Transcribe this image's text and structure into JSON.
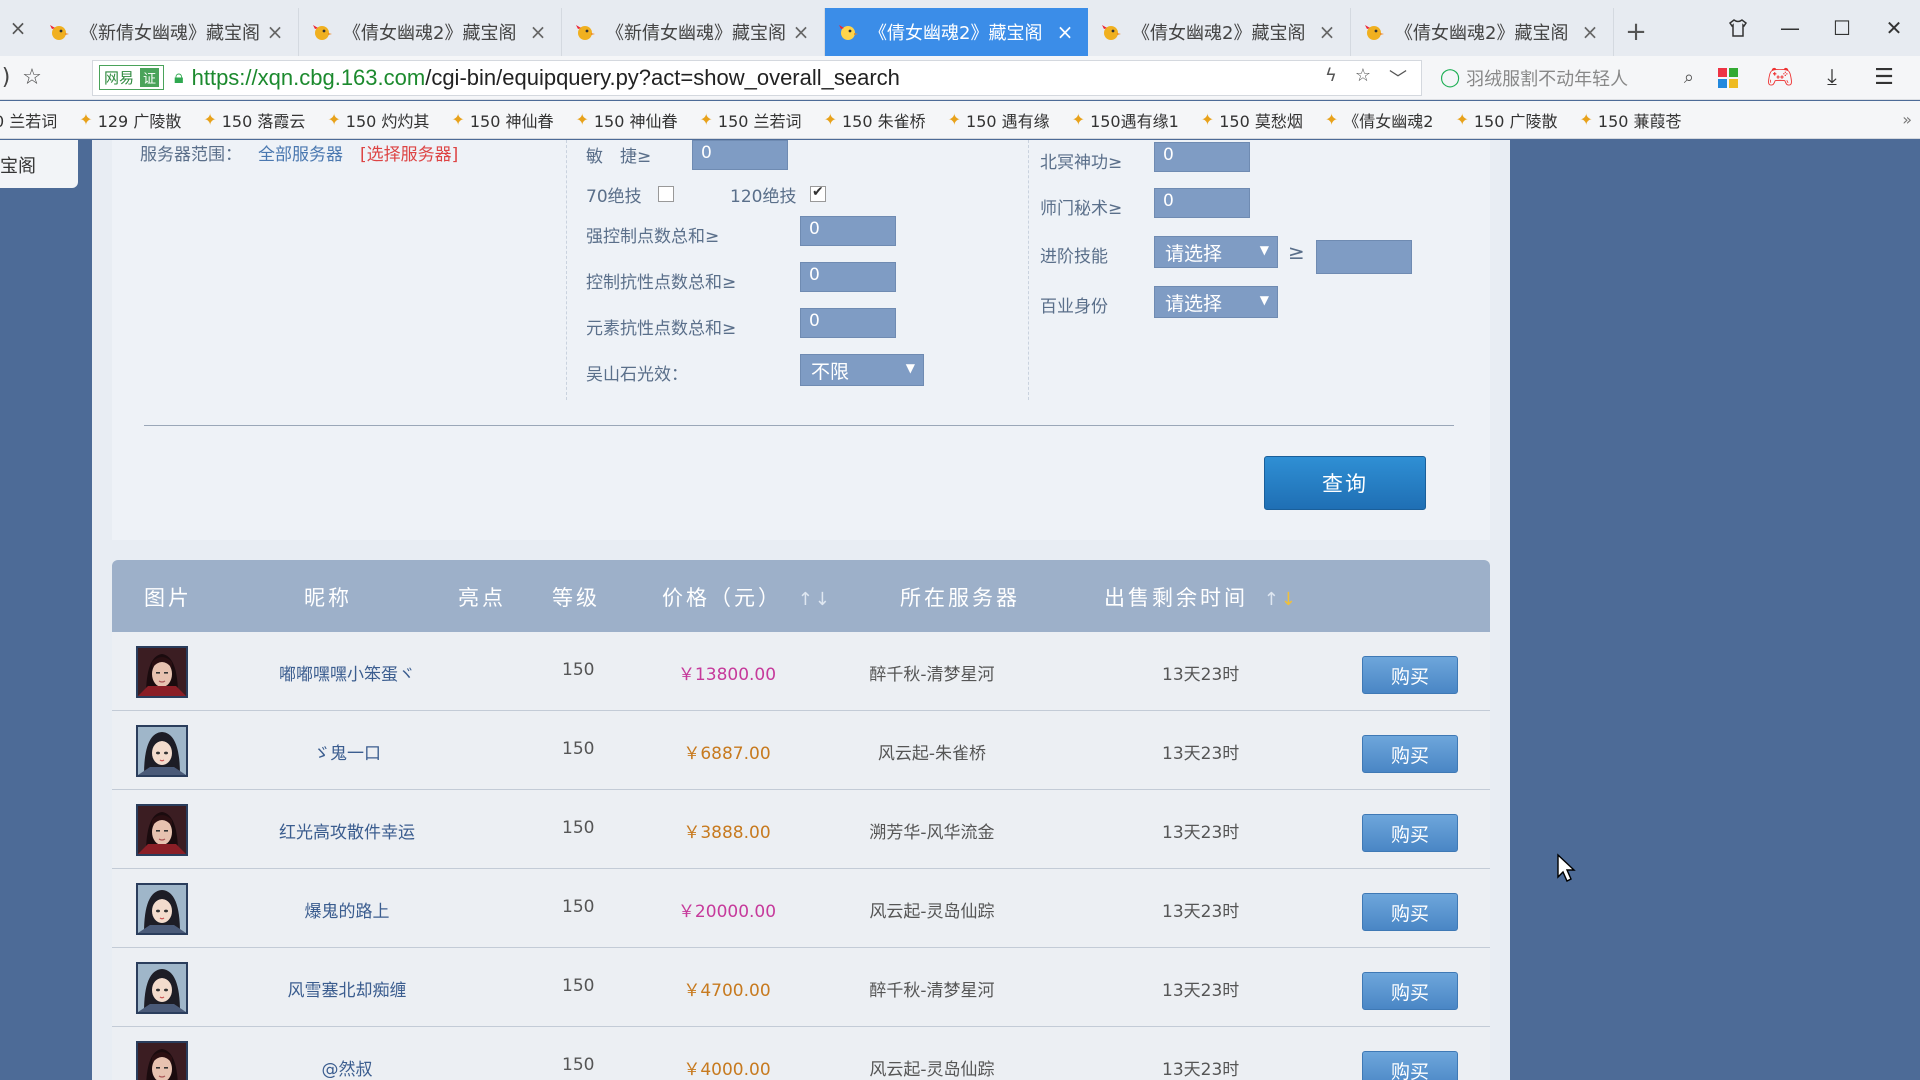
{
  "browser": {
    "tab_stub_close": "×",
    "tabs": [
      {
        "title": "《新倩女幽魂》藏宝阁",
        "active": false
      },
      {
        "title": "《倩女幽魂2》藏宝阁",
        "active": false
      },
      {
        "title": "《新倩女幽魂》藏宝阁",
        "active": false
      },
      {
        "title": "《倩女幽魂2》藏宝阁",
        "active": true
      },
      {
        "title": "《倩女幽魂2》藏宝阁",
        "active": false
      },
      {
        "title": "《倩女幽魂2》藏宝阁",
        "active": false
      }
    ],
    "tab_close": "×",
    "new_tab": "+",
    "url_badge": "网易",
    "url_badge_cert": "证",
    "url_protocol": "https://",
    "url_host": "xqn.cbg.163.com",
    "url_path": "/cgi-bin/equipquery.py?act=show_overall_search",
    "search_placeholder": "羽绒服割不动年轻人",
    "accent": "#3b8de8"
  },
  "bookmarks": [
    "0 兰若词",
    "129 广陵散",
    "150 落霞云",
    "150 灼灼其",
    "150 神仙眷",
    "150 神仙眷",
    "150 兰若词",
    "150 朱雀桥",
    "150 遇有缘",
    "150遇有缘1",
    "150 莫愁烟",
    "《倩女幽魂2",
    "150 广陵散",
    "150 蒹葭苍"
  ],
  "bookmarks_more": "»",
  "side_tab": "宝阁",
  "filters": {
    "server_range_label": "服务器范围：",
    "server_range_value": "全部服务器",
    "server_select_link": "[选择服务器]",
    "agility_label": "敏　捷≥",
    "agility_value": "0",
    "skill70_label": "70绝技",
    "skill70_checked": false,
    "skill120_label": "120绝技",
    "skill120_checked": true,
    "strong_control_label": "强控制点数总和≥",
    "strong_control_value": "0",
    "control_resist_label": "控制抗性点数总和≥",
    "control_resist_value": "0",
    "element_resist_label": "元素抗性点数总和≥",
    "element_resist_value": "0",
    "wushan_label": "吴山石光效：",
    "wushan_value": "不限",
    "beiming_label": "北冥神功≥",
    "beiming_value": "0",
    "shimen_label": "师门秘术≥",
    "shimen_value": "0",
    "advanced_skill_label": "进阶技能",
    "advanced_skill_value": "请选择",
    "advanced_skill_ge": "≥",
    "advanced_skill_input": "",
    "baiye_label": "百业身份",
    "baiye_value": "请选择",
    "query_button": "查询"
  },
  "table": {
    "headers": {
      "image": "图片",
      "nickname": "昵称",
      "highlight": "亮点",
      "level": "等级",
      "price": "价格（元）",
      "server": "所在服务器",
      "time_left": "出售剩余时间"
    },
    "sort_arrows": "↑↓",
    "rows": [
      {
        "avatar": "male-avatar",
        "nickname": "嘟嘟嘿嘿小笨蛋ヾ",
        "level": "150",
        "price": "￥13800.00",
        "price_highlight": true,
        "server": "醉千秋-清梦星河",
        "time_left": "13天23时",
        "buy": "购买"
      },
      {
        "avatar": "female-avatar",
        "nickname": "ゞ鬼一口",
        "level": "150",
        "price": "￥6887.00",
        "price_highlight": false,
        "server": "风云起-朱雀桥",
        "time_left": "13天23时",
        "buy": "购买"
      },
      {
        "avatar": "male-avatar",
        "nickname": "红光高攻散件幸运",
        "level": "150",
        "price": "￥3888.00",
        "price_highlight": false,
        "server": "溯芳华-风华流金",
        "time_left": "13天23时",
        "buy": "购买"
      },
      {
        "avatar": "female-avatar",
        "nickname": "爆鬼的路上",
        "level": "150",
        "price": "￥20000.00",
        "price_highlight": true,
        "server": "风云起-灵岛仙踪",
        "time_left": "13天23时",
        "buy": "购买"
      },
      {
        "avatar": "female-avatar",
        "nickname": "风雪塞北却痴缠",
        "level": "150",
        "price": "￥4700.00",
        "price_highlight": false,
        "server": "醉千秋-清梦星河",
        "time_left": "13天23时",
        "buy": "购买"
      },
      {
        "avatar": "male-avatar",
        "nickname": "@然叔",
        "level": "150",
        "price": "￥4000.00",
        "price_highlight": false,
        "server": "风云起-灵岛仙踪",
        "time_left": "13天23时",
        "buy": "购买"
      }
    ]
  }
}
